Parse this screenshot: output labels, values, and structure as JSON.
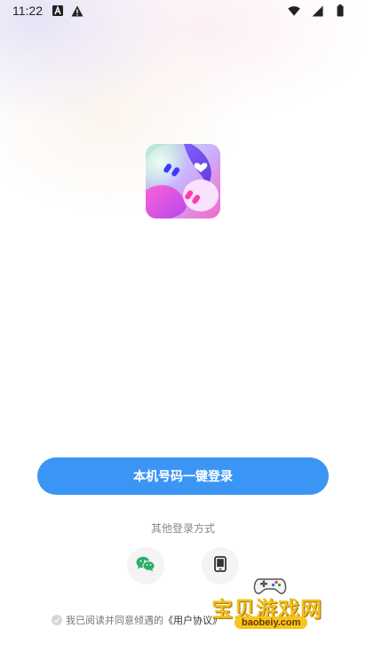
{
  "status_bar": {
    "time": "11:22",
    "left_icons": [
      "text-a-icon",
      "warning-icon"
    ],
    "right_icons": [
      "wifi-icon",
      "cell-signal-icon",
      "battery-icon"
    ]
  },
  "logo": {
    "icon": "app-logo"
  },
  "primary_login": {
    "label": "本机号码一键登录",
    "color": "#3a95f5"
  },
  "other_methods": {
    "label": "其他登录方式",
    "options": [
      {
        "name": "wechat",
        "icon": "wechat-icon",
        "color": "#2aae67"
      },
      {
        "name": "phone",
        "icon": "phone-icon",
        "color": "#333333"
      }
    ]
  },
  "agreement": {
    "prefix": "我已阅读并同意倾遇的",
    "link": "《用户协议》"
  },
  "watermark": {
    "text": "宝贝游戏网",
    "url": "baobeiy.com"
  }
}
